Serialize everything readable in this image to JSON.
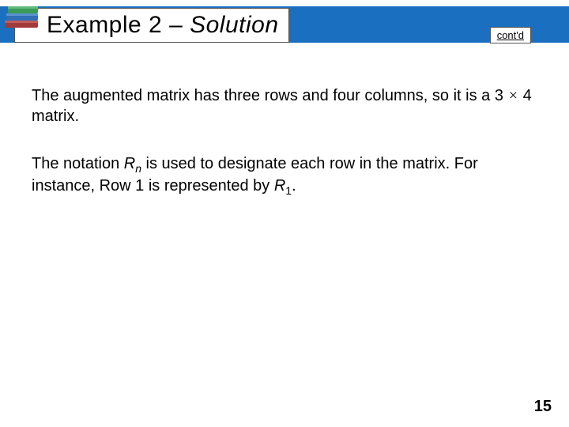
{
  "header": {
    "title_plain": "Example 2 – ",
    "title_italic": "Solution",
    "contd": "cont'd"
  },
  "body": {
    "p1_a": "The augmented matrix has three rows and four columns, so it is a 3 ",
    "p1_mult": "×",
    "p1_b": " 4 matrix.",
    "p2_a": "The notation ",
    "p2_R": "R",
    "p2_n": "n",
    "p2_b": " is used to designate each row in the matrix. For instance, Row 1 is represented by ",
    "p2_R2": "R",
    "p2_one": "1",
    "p2_c": "."
  },
  "page": "15"
}
